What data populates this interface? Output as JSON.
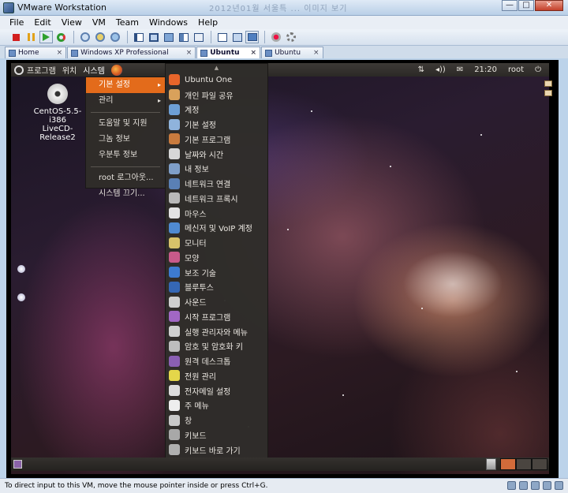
{
  "window": {
    "title": "VMware Workstation",
    "blurred_text": "2012년01월 서울특 ... 이미지 보기",
    "minimize": "—",
    "maximize": "□",
    "close": "✕"
  },
  "menubar": [
    "File",
    "Edit",
    "View",
    "VM",
    "Team",
    "Windows",
    "Help"
  ],
  "tabs": [
    {
      "label": "Home",
      "active": false
    },
    {
      "label": "Windows XP Professional",
      "active": false
    },
    {
      "label": "Ubuntu",
      "active": true
    },
    {
      "label": "Ubuntu",
      "active": false
    }
  ],
  "tab_close": "×",
  "guest_top_panel": {
    "menus": [
      "프로그램",
      "위치",
      "시스템"
    ],
    "clock": "21:20",
    "user": "root",
    "network_icon": "⇅",
    "volume_icon": "◂))",
    "mail_icon": "✉",
    "power_icon": "⏻"
  },
  "desktop_icon": {
    "line1": "CentOS-5.5-i386",
    "line2": "LiveCD-Release2"
  },
  "system_menu": {
    "items": [
      {
        "label": "기본 설정",
        "submenu": true,
        "active": true
      },
      {
        "label": "관리",
        "submenu": true,
        "active": false
      },
      {
        "separator": true
      },
      {
        "label": "도움말 및 지원"
      },
      {
        "label": "그놈 정보"
      },
      {
        "label": "우분투 정보"
      },
      {
        "separator": true
      },
      {
        "label": "root 로그아웃..."
      },
      {
        "label": "시스템 끄기..."
      }
    ],
    "arrow": "▸"
  },
  "prefs_menu": {
    "scroll_up": "▲",
    "scroll_down": "▼",
    "items": [
      {
        "label": "Ubuntu One",
        "color": "#e8652a"
      },
      {
        "label": "개인 파일 공유",
        "color": "#d9a15b"
      },
      {
        "label": "계정",
        "color": "#6d9fd6"
      },
      {
        "label": "기본 설정",
        "color": "#8fb3dc"
      },
      {
        "label": "기본 프로그램",
        "color": "#c97b3e"
      },
      {
        "label": "날짜와 시간",
        "color": "#d7d7d7"
      },
      {
        "label": "내 정보",
        "color": "#7f9fc9"
      },
      {
        "label": "네트워크 연결",
        "color": "#5a80b5"
      },
      {
        "label": "네트워크 프록시",
        "color": "#b9b9b9"
      },
      {
        "label": "마우스",
        "color": "#e3e3e3"
      },
      {
        "label": "메신저 및 VoIP 계정",
        "color": "#4f8ad1"
      },
      {
        "label": "모니터",
        "color": "#d8c26a"
      },
      {
        "label": "모양",
        "color": "#c85a8a"
      },
      {
        "label": "보조 기술",
        "color": "#3d7bd1"
      },
      {
        "label": "블루투스",
        "color": "#3567b5"
      },
      {
        "label": "사운드",
        "color": "#cfcfcf"
      },
      {
        "label": "시작 프로그램",
        "color": "#a167c4"
      },
      {
        "label": "실행 관리자와 메뉴",
        "color": "#cfcfcf"
      },
      {
        "label": "암호 및 암호화 키",
        "color": "#bdbdbd"
      },
      {
        "label": "원격 데스크톱",
        "color": "#8a5fb3"
      },
      {
        "label": "전원 관리",
        "color": "#e4d64a"
      },
      {
        "label": "전자메일 설정",
        "color": "#dcdcdc"
      },
      {
        "label": "주 메뉴",
        "color": "#eeeeee"
      },
      {
        "label": "창",
        "color": "#c8c8c8"
      },
      {
        "label": "키보드",
        "color": "#a8a8a8"
      },
      {
        "label": "키보드 바로 가기",
        "color": "#b0b0b0"
      }
    ]
  },
  "statusbar": {
    "text": "To direct input to this VM, move the mouse pointer inside or press Ctrl+G."
  }
}
